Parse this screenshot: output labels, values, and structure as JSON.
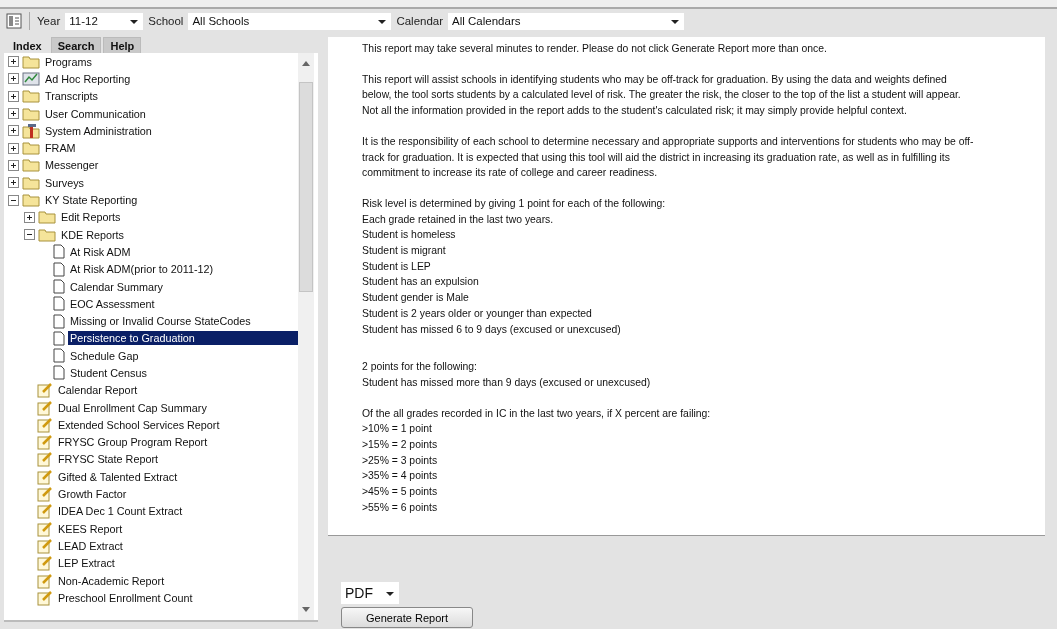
{
  "toolbar": {
    "year": {
      "label": "Year",
      "value": "11-12"
    },
    "school": {
      "label": "School",
      "value": "All Schools"
    },
    "calendar": {
      "label": "Calendar",
      "value": "All Calendars"
    }
  },
  "tabs": [
    {
      "label": "Index",
      "selected": true
    },
    {
      "label": "Search",
      "selected": false
    },
    {
      "label": "Help",
      "selected": false
    }
  ],
  "tree": [
    {
      "label": "Programs",
      "kind": "folder",
      "expanded": false,
      "selected": false
    },
    {
      "label": "Ad Hoc Reporting",
      "kind": "adhoc",
      "expanded": false,
      "selected": false
    },
    {
      "label": "Transcripts",
      "kind": "folder",
      "expanded": false,
      "selected": false
    },
    {
      "label": "User Communication",
      "kind": "folder",
      "expanded": false,
      "selected": false
    },
    {
      "label": "System Administration",
      "kind": "admin",
      "expanded": false,
      "selected": false
    },
    {
      "label": "FRAM",
      "kind": "folder",
      "expanded": false,
      "selected": false
    },
    {
      "label": "Messenger",
      "kind": "folder",
      "expanded": false,
      "selected": false
    },
    {
      "label": "Surveys",
      "kind": "folder",
      "expanded": false,
      "selected": false
    },
    {
      "label": "KY State Reporting",
      "kind": "folder",
      "expanded": true,
      "selected": false,
      "children": [
        {
          "label": "Edit Reports",
          "kind": "folder",
          "expanded": false,
          "selected": false
        },
        {
          "label": "KDE Reports",
          "kind": "folder",
          "expanded": true,
          "selected": false,
          "children": [
            {
              "label": "At Risk ADM",
              "kind": "page",
              "selected": false
            },
            {
              "label": "At Risk ADM(prior to 2011-12)",
              "kind": "page",
              "selected": false
            },
            {
              "label": "Calendar Summary",
              "kind": "page",
              "selected": false
            },
            {
              "label": "EOC Assessment",
              "kind": "page",
              "selected": false
            },
            {
              "label": "Missing or Invalid Course StateCodes",
              "kind": "page",
              "selected": false
            },
            {
              "label": "Persistence to Graduation",
              "kind": "page",
              "selected": true
            },
            {
              "label": "Schedule Gap",
              "kind": "page",
              "selected": false
            },
            {
              "label": "Student Census",
              "kind": "page",
              "selected": false
            }
          ]
        },
        {
          "label": "Calendar Report",
          "kind": "report",
          "selected": false
        },
        {
          "label": "Dual Enrollment Cap Summary",
          "kind": "report",
          "selected": false
        },
        {
          "label": "Extended School Services Report",
          "kind": "report",
          "selected": false
        },
        {
          "label": "FRYSC Group Program Report",
          "kind": "report",
          "selected": false
        },
        {
          "label": "FRYSC State Report",
          "kind": "report",
          "selected": false
        },
        {
          "label": "Gifted & Talented Extract",
          "kind": "report",
          "selected": false
        },
        {
          "label": "Growth Factor",
          "kind": "report",
          "selected": false
        },
        {
          "label": "IDEA Dec 1 Count Extract",
          "kind": "report",
          "selected": false
        },
        {
          "label": "KEES Report",
          "kind": "report",
          "selected": false
        },
        {
          "label": "LEAD Extract",
          "kind": "report",
          "selected": false
        },
        {
          "label": "LEP Extract",
          "kind": "report",
          "selected": false
        },
        {
          "label": "Non-Academic Report",
          "kind": "report",
          "selected": false
        },
        {
          "label": "Preschool Enrollment Count",
          "kind": "report",
          "selected": false
        }
      ]
    }
  ],
  "report_text": [
    [
      "This report may take several minutes to render. Please do not click Generate Report more than once."
    ],
    [
      "This report will assist schools in identifying students who may be off-track for graduation. By using the data and weights defined below, the tool sorts students by a calculated level of risk. The greater the risk, the closer to the top of the list a student will appear. Not all the information provided in the report adds to the student's calculated risk; it may simply provide helpful context."
    ],
    [
      "It is the responsibility of each school to determine necessary and appropriate supports and interventions for students who may be off-track for graduation. It is expected that using this tool will aid the district in increasing its graduation rate, as well as in fulfilling its commitment to increase its rate of college and career readiness."
    ],
    [
      "Risk level is determined by giving 1 point for each of the following:",
      "Each grade retained in the last two years.",
      "Student is homeless",
      "Student is migrant",
      "Student is LEP",
      "Student has an expulsion",
      "Student gender is Male",
      "Student is 2 years older or younger than expected",
      "Student has missed 6 to 9 days (excused or unexcused)"
    ],
    [
      "2 points for the following:",
      "Student has missed more than 9 days (excused or unexcused)"
    ],
    [
      "Of the all grades recorded in IC in the last two years, if X percent are failing:",
      ">10% = 1 point",
      ">15% = 2 points",
      ">25% = 3 points",
      ">35% = 4 points",
      ">45% = 5 points",
      ">55% = 6 points"
    ]
  ],
  "format": "PDF",
  "generate_button": "Generate Report"
}
